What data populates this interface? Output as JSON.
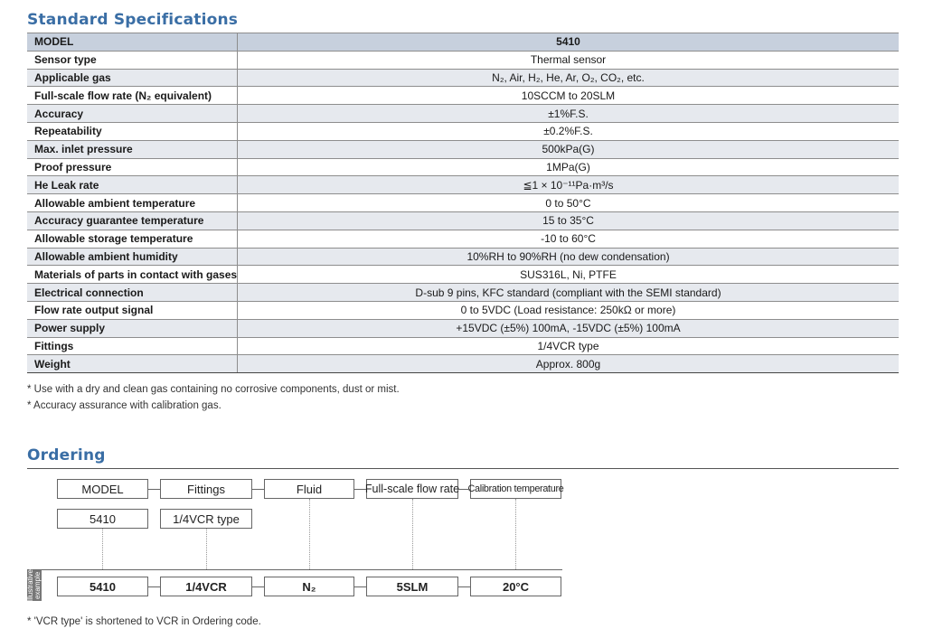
{
  "spec": {
    "title": "Standard Specifications",
    "header": {
      "label": "MODEL",
      "value": "5410"
    },
    "rows": [
      {
        "label": "Sensor type",
        "value": "Thermal sensor"
      },
      {
        "label": "Applicable gas",
        "value": "N₂, Air, H₂, He, Ar, O₂, CO₂, etc."
      },
      {
        "label": "Full-scale flow rate (N₂ equivalent)",
        "value": "10SCCM to 20SLM"
      },
      {
        "label": "Accuracy",
        "value": "±1%F.S."
      },
      {
        "label": "Repeatability",
        "value": "±0.2%F.S."
      },
      {
        "label": "Max. inlet pressure",
        "value": "500kPa(G)"
      },
      {
        "label": "Proof pressure",
        "value": "1MPa(G)"
      },
      {
        "label": "He Leak rate",
        "value": "≦1 × 10⁻¹¹Pa·m³/s"
      },
      {
        "label": "Allowable ambient temperature",
        "value": "0 to 50°C"
      },
      {
        "label": "Accuracy guarantee temperature",
        "value": "15 to 35°C"
      },
      {
        "label": "Allowable storage temperature",
        "value": "-10 to 60°C"
      },
      {
        "label": "Allowable ambient humidity",
        "value": "10%RH to 90%RH (no dew condensation)"
      },
      {
        "label": "Materials of parts in contact with gases",
        "value": "SUS316L, Ni, PTFE"
      },
      {
        "label": "Electrical connection",
        "value": "D-sub 9 pins, KFC standard (compliant with the SEMI standard)"
      },
      {
        "label": "Flow rate output signal",
        "value": "0 to 5VDC (Load resistance: 250kΩ or more)"
      },
      {
        "label": "Power supply",
        "value": "+15VDC (±5%) 100mA, -15VDC (±5%) 100mA"
      },
      {
        "label": "Fittings",
        "value": "1/4VCR type"
      },
      {
        "label": "Weight",
        "value": "Approx. 800g"
      }
    ],
    "notes": [
      "* Use with a dry and clean gas containing no corrosive components, dust or mist.",
      "* Accuracy assurance with calibration gas."
    ]
  },
  "ordering": {
    "title": "Ordering",
    "headers": [
      "MODEL",
      "Fittings",
      "Fluid",
      "Full-scale flow rate",
      "Calibration temperature"
    ],
    "options": [
      "5410",
      "1/4VCR type"
    ],
    "example_label": "Illustrative example",
    "example": [
      "5410",
      "1/4VCR",
      "N₂",
      "5SLM",
      "20°C"
    ],
    "note": "* 'VCR type' is shortened to VCR in Ordering code."
  }
}
